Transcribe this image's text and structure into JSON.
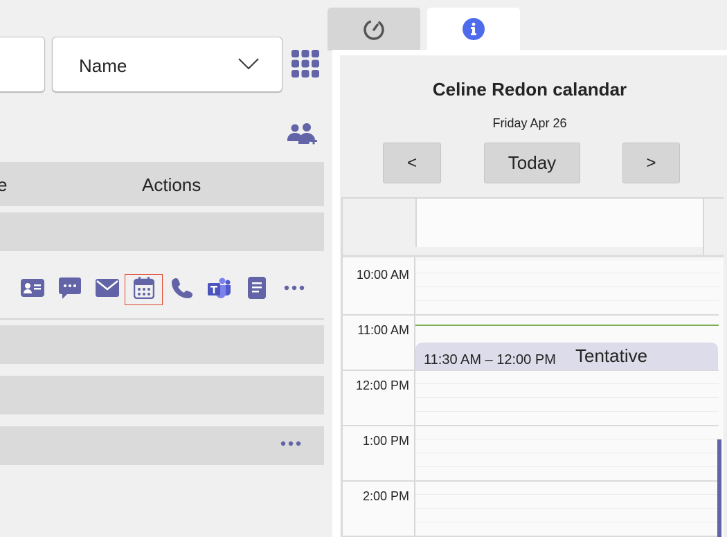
{
  "colors": {
    "accent": "#6264a7",
    "info_blue": "#4f6bed",
    "now_line": "#7cae55",
    "event_bg": "#dcdcea",
    "focus_red": "#e0442b"
  },
  "toolbar": {
    "sort_value": "Name",
    "apps_icon": "grid-icon",
    "add_people_icon": "add-people-icon"
  },
  "table": {
    "header_left_fragment": "e",
    "header_actions": "Actions",
    "action_icons": [
      "contact-card-icon",
      "chat-icon",
      "mail-icon",
      "calendar-icon",
      "phone-icon",
      "teams-icon",
      "notes-icon",
      "more-icon"
    ],
    "focused_action": "calendar-icon"
  },
  "tabs": [
    {
      "icon": "history-icon",
      "active": false
    },
    {
      "icon": "info-icon",
      "active": true
    }
  ],
  "calendar": {
    "title": "Celine Redon calandar",
    "date": "Friday Apr 26",
    "prev_label": "<",
    "today_label": "Today",
    "next_label": ">",
    "hours": [
      "10:00 AM",
      "11:00 AM",
      "12:00 PM",
      "1:00 PM",
      "2:00 PM"
    ],
    "event": {
      "time": "11:30 AM – 12:00 PM",
      "status": "Tentative"
    }
  }
}
